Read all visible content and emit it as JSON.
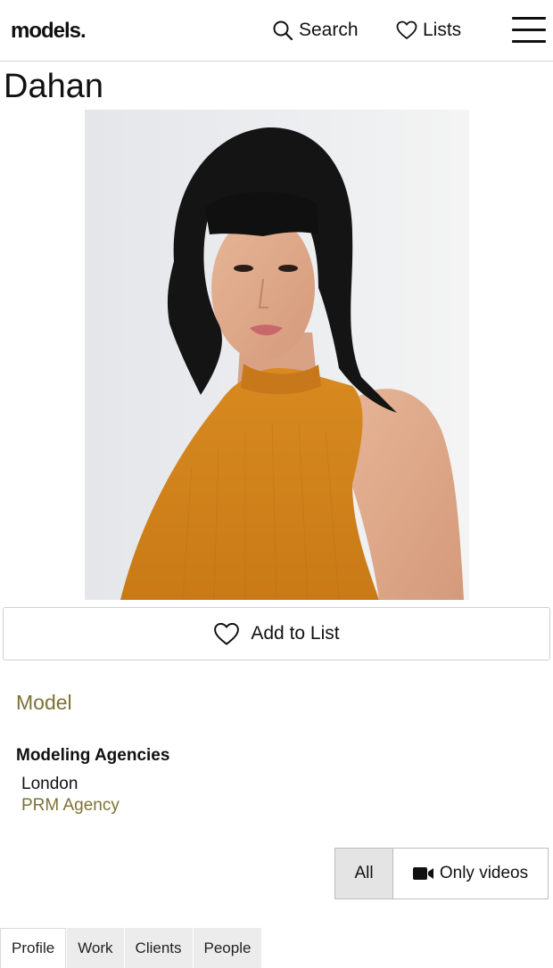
{
  "header": {
    "logo": "models.",
    "search_label": "Search",
    "lists_label": "Lists"
  },
  "profile": {
    "name": "Dahan",
    "add_to_list_label": "Add to List",
    "role": "Model",
    "agencies_heading": "Modeling Agencies",
    "agency_city": "London",
    "agency_name": "PRM Agency"
  },
  "filter": {
    "all_label": "All",
    "videos_label": "Only videos"
  },
  "tabs": [
    {
      "label": "Profile",
      "active": true
    },
    {
      "label": "Work"
    },
    {
      "label": "Clients"
    },
    {
      "label": "People"
    }
  ],
  "colors": {
    "accent": "#7d7234",
    "top_color": "#d98a22",
    "hair": "#141414",
    "background_wall": "#e9eaec"
  },
  "icons": {
    "search": "search-icon",
    "lists": "heart-icon",
    "menu": "hamburger-menu-icon",
    "add_to_list": "heart-icon",
    "videos": "video-camera-icon"
  }
}
